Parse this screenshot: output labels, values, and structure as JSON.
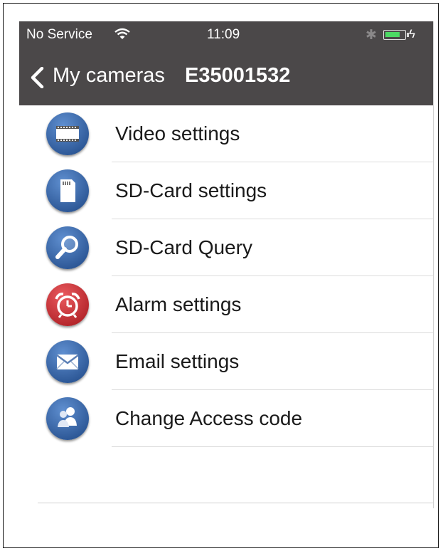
{
  "status_bar": {
    "carrier": "No Service",
    "time": "11:09",
    "bluetooth_icon": "bluetooth-icon",
    "wifi_icon": "wifi-icon",
    "battery_icon": "battery-icon",
    "charging_icon": "charging-bolt-icon"
  },
  "nav": {
    "back_label": "My cameras",
    "title": "E35001532"
  },
  "menu": [
    {
      "label": "Video settings",
      "icon": "film-strip-icon",
      "color": "#2c5a9c"
    },
    {
      "label": "SD-Card settings",
      "icon": "sd-card-icon",
      "color": "#2c5a9c"
    },
    {
      "label": "SD-Card Query",
      "icon": "magnifier-icon",
      "color": "#2c5a9c"
    },
    {
      "label": "Alarm settings",
      "icon": "alarm-clock-icon",
      "color": "#c42026"
    },
    {
      "label": "Email settings",
      "icon": "envelope-icon",
      "color": "#2c5a9c"
    },
    {
      "label": "Change Access code",
      "icon": "users-icon",
      "color": "#2c5a9c"
    }
  ],
  "colors": {
    "bar_background": "#4b4849",
    "icon_blue": "#2c5a9c",
    "icon_red": "#c42026",
    "battery_green": "#4cd964"
  }
}
